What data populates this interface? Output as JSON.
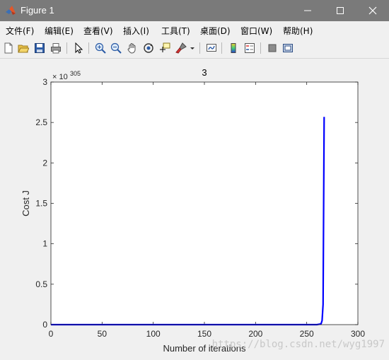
{
  "window": {
    "title": "Figure 1",
    "icon": "matlab-icon",
    "controls": [
      "minimize-icon",
      "maximize-icon",
      "close-icon"
    ]
  },
  "menubar": {
    "items": [
      {
        "label": "文件(F)"
      },
      {
        "label": "编辑(E)"
      },
      {
        "label": "查看(V)"
      },
      {
        "label": "插入(I)"
      },
      {
        "label": "工具(T)"
      },
      {
        "label": "桌面(D)"
      },
      {
        "label": "窗口(W)"
      },
      {
        "label": "帮助(H)"
      }
    ]
  },
  "toolbar": {
    "icons": [
      "new-figure-icon",
      "open-file-icon",
      "save-icon",
      "print-icon",
      "edit-plot-icon",
      "zoom-in-icon",
      "zoom-out-icon",
      "pan-icon",
      "rotate-3d-icon",
      "data-cursor-icon",
      "brush-icon",
      "link-plot-icon",
      "insert-colorbar-icon",
      "insert-legend-icon",
      "hide-plot-tools-icon",
      "show-plot-tools-icon"
    ]
  },
  "chart_data": {
    "type": "line",
    "title": "3",
    "xlabel": "Number of iterations",
    "ylabel": "Cost J",
    "xlim": [
      0,
      300
    ],
    "ylim": [
      0,
      3
    ],
    "xticks": [
      "0",
      "50",
      "100",
      "150",
      "200",
      "250",
      "300"
    ],
    "yticks": [
      "0",
      "0.5",
      "1",
      "1.5",
      "2",
      "2.5",
      "3"
    ],
    "y_exponent_label": "× 10",
    "y_exponent": "305",
    "grid": false,
    "series": [
      {
        "color": "#0000ff",
        "x": [
          0,
          100,
          200,
          260,
          264,
          265,
          266,
          267
        ],
        "y": [
          0,
          0,
          0,
          0,
          0.01,
          0.05,
          0.25,
          2.57
        ]
      }
    ]
  },
  "watermark": "https://blog.csdn.net/wyg1997"
}
